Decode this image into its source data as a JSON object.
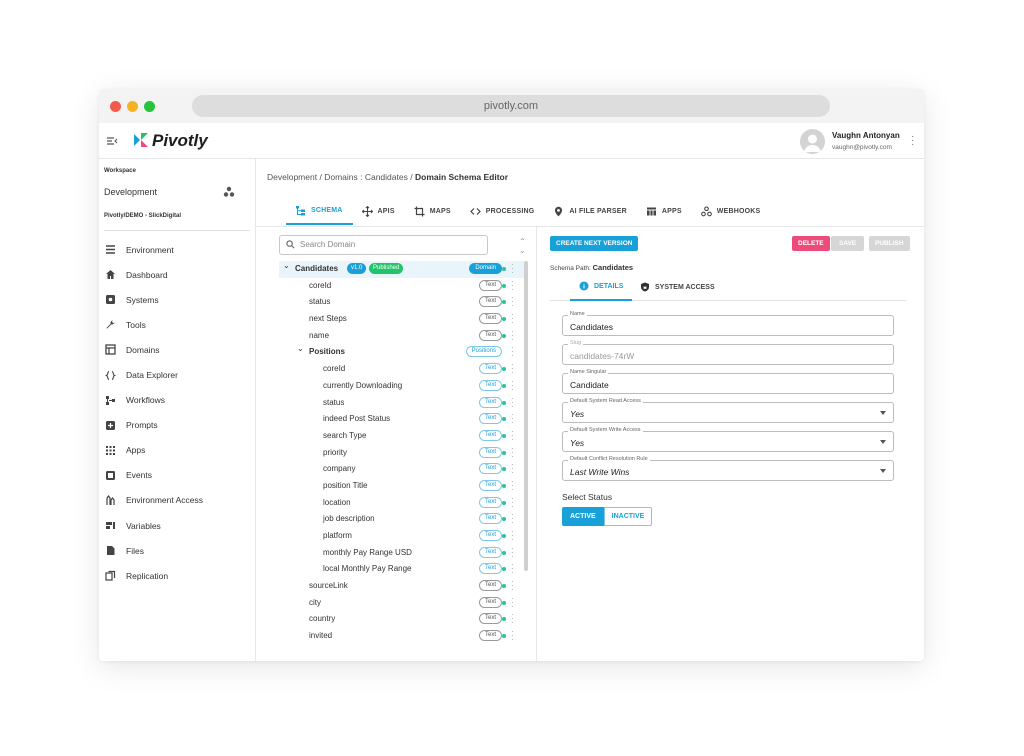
{
  "browser": {
    "url": "pivotly.com"
  },
  "app": {
    "name": "Pivotly"
  },
  "user": {
    "name": "Vaughn Antonyan",
    "email": "vaughn@pivotly.com"
  },
  "workspace": {
    "label": "Workspace",
    "selected": "Development",
    "path": "Pivotly/DEMO - SlickDigital"
  },
  "sidebar": {
    "items": [
      {
        "label": "Environment",
        "icon": "list-icon"
      },
      {
        "label": "Dashboard",
        "icon": "home-icon"
      },
      {
        "label": "Systems",
        "icon": "systems-icon"
      },
      {
        "label": "Tools",
        "icon": "wrench-icon"
      },
      {
        "label": "Domains",
        "icon": "domains-icon"
      },
      {
        "label": "Data Explorer",
        "icon": "braces-icon"
      },
      {
        "label": "Workflows",
        "icon": "workflow-icon"
      },
      {
        "label": "Prompts",
        "icon": "prompt-icon"
      },
      {
        "label": "Apps",
        "icon": "apps-grid-icon"
      },
      {
        "label": "Events",
        "icon": "events-icon"
      },
      {
        "label": "Environment Access",
        "icon": "access-icon"
      },
      {
        "label": "Variables",
        "icon": "variables-icon"
      },
      {
        "label": "Files",
        "icon": "file-icon"
      },
      {
        "label": "Replication",
        "icon": "copy-icon"
      }
    ]
  },
  "breadcrumb": {
    "part1": "Development",
    "sep": "/",
    "part2": "Domains : Candidates",
    "current": "Domain Schema Editor"
  },
  "tabs": [
    {
      "label": "SCHEMA",
      "icon": "schema-icon",
      "active": true
    },
    {
      "label": "APIS",
      "icon": "api-icon",
      "active": false
    },
    {
      "label": "MAPS",
      "icon": "crop-icon",
      "active": false
    },
    {
      "label": "PROCESSING",
      "icon": "code-icon",
      "active": false
    },
    {
      "label": "AI FILE PARSER",
      "icon": "pin-icon",
      "active": false
    },
    {
      "label": "APPS",
      "icon": "table-icon",
      "active": false
    },
    {
      "label": "WEBHOOKS",
      "icon": "webhook-icon",
      "active": false
    }
  ],
  "tree": {
    "search_placeholder": "Search Domain",
    "root": {
      "label": "Candidates",
      "version": "v1.0",
      "status": "Published",
      "type": "Domain"
    },
    "fields": [
      {
        "label": "coreId",
        "type": "Text"
      },
      {
        "label": "status",
        "type": "Text"
      },
      {
        "label": "next Steps",
        "type": "Text"
      },
      {
        "label": "name",
        "type": "Text"
      }
    ],
    "group": {
      "label": "Positions",
      "type": "Positions"
    },
    "group_fields": [
      {
        "label": "coreId",
        "type": "Text"
      },
      {
        "label": "currently Downloading",
        "type": "Text"
      },
      {
        "label": "status",
        "type": "Text"
      },
      {
        "label": "indeed Post Status",
        "type": "Text"
      },
      {
        "label": "search Type",
        "type": "Text"
      },
      {
        "label": "priority",
        "type": "Text"
      },
      {
        "label": "company",
        "type": "Text"
      },
      {
        "label": "position Title",
        "type": "Text"
      },
      {
        "label": "location",
        "type": "Text"
      },
      {
        "label": "job description",
        "type": "Text"
      },
      {
        "label": "platform",
        "type": "Text"
      },
      {
        "label": "monthly Pay Range USD",
        "type": "Text"
      },
      {
        "label": "local Monthly Pay Range",
        "type": "Text"
      }
    ],
    "tail_fields": [
      {
        "label": "sourceLink",
        "type": "Text"
      },
      {
        "label": "city",
        "type": "Text"
      },
      {
        "label": "country",
        "type": "Text"
      },
      {
        "label": "invited",
        "type": "Text"
      }
    ]
  },
  "detail": {
    "create_label": "CREATE NEXT VERSION",
    "delete_label": "DELETE",
    "save_label": "SAVE",
    "publish_label": "PUBLISH",
    "schema_path_label": "Schema Path:",
    "schema_path_value": "Candidates",
    "tab_details": "DETAILS",
    "tab_access": "SYSTEM ACCESS",
    "fields": {
      "name": {
        "label": "Name",
        "value": "Candidates"
      },
      "slug": {
        "label": "Slug",
        "value": "candidates-74rW"
      },
      "singular": {
        "label": "Name Singular",
        "value": "Candidate"
      },
      "read": {
        "label": "Default System Read Access",
        "value": "Yes"
      },
      "write": {
        "label": "Default System Write Access",
        "value": "Yes"
      },
      "conflict": {
        "label": "Default Conflict Resolution Rule",
        "value": "Last Write Wins"
      }
    },
    "status_label": "Select Status",
    "status_active": "ACTIVE",
    "status_inactive": "INACTIVE"
  },
  "colors": {
    "accent": "#1aa0d8",
    "delete": "#ec4b7c",
    "published": "#22c36a",
    "dot": "#29c39a"
  }
}
